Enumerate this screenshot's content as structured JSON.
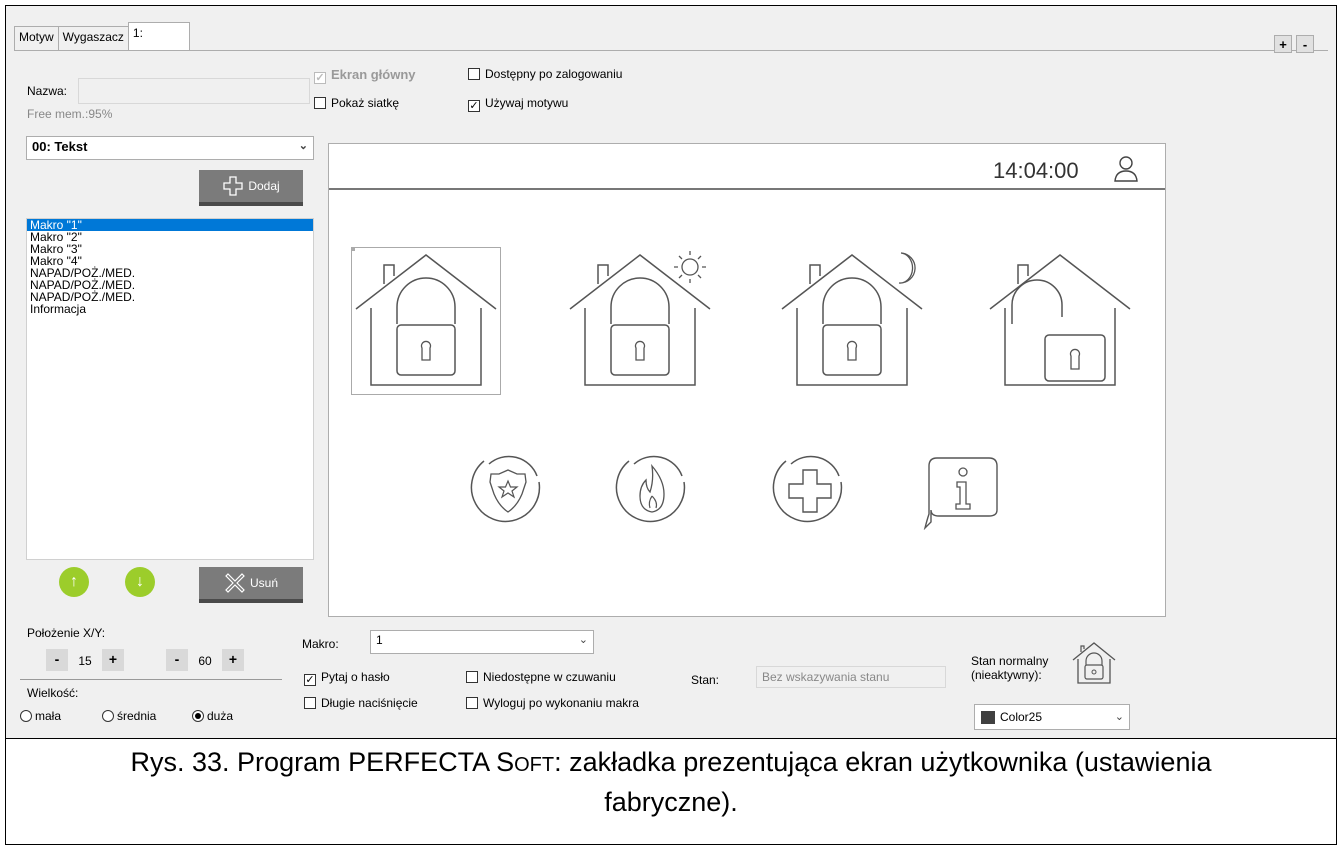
{
  "tabs": [
    "Motyw",
    "Wygaszacz",
    "1:"
  ],
  "window_buttons": {
    "add": "+",
    "remove": "-"
  },
  "left": {
    "name_label": "Nazwa:",
    "name_value": "",
    "free_mem": "Free mem.:95%",
    "type_select": "00: Tekst",
    "add_label": "Dodaj",
    "items": [
      "Makro \"1\"",
      "Makro \"2\"",
      "Makro \"3\"",
      "Makro \"4\"",
      "NAPAD/POŻ./MED.",
      "NAPAD/POŻ./MED.",
      "NAPAD/POŻ./MED.",
      "Informacja"
    ],
    "selected_index": 0,
    "delete_label": "Usuń",
    "position_label": "Położenie X/Y:",
    "x_value": "15",
    "y_value": "60",
    "minus": "-",
    "plus": "+",
    "size_label": "Wielkość:",
    "size_options": [
      "mała",
      "średnia",
      "duża"
    ],
    "size_selected": "duża"
  },
  "options": {
    "main_screen": "Ekran główny",
    "after_login": "Dostępny po zalogowaniu",
    "show_grid": "Pokaż siatkę",
    "use_theme": "Używaj motywu"
  },
  "screen": {
    "time": "14:04:00",
    "icons": [
      "house-lock-icon",
      "house-lock-day-icon",
      "house-lock-night-icon",
      "house-unlock-icon",
      "police-icon",
      "fire-icon",
      "medical-icon",
      "info-icon"
    ]
  },
  "macro": {
    "label": "Makro:",
    "value": "1",
    "ask_password": "Pytaj o hasło",
    "long_press": "Długie naciśnięcie",
    "unavailable_armed": "Niedostępne w czuwaniu",
    "logout_after": "Wyloguj po wykonaniu makra",
    "state_label": "Stan:",
    "state_value": "Bez wskazywania stanu",
    "normal_state_line1": "Stan normalny",
    "normal_state_line2": "(nieaktywny):",
    "color_value": "Color25",
    "color_swatch": "#404040"
  },
  "caption": {
    "line1_pre": "Rys. 33. Program PERFECTA S",
    "line1_sc": "OFT",
    "line1_post": ": zakładka prezentująca ekran użytkownika (ustawienia",
    "line2": "fabryczne)."
  }
}
